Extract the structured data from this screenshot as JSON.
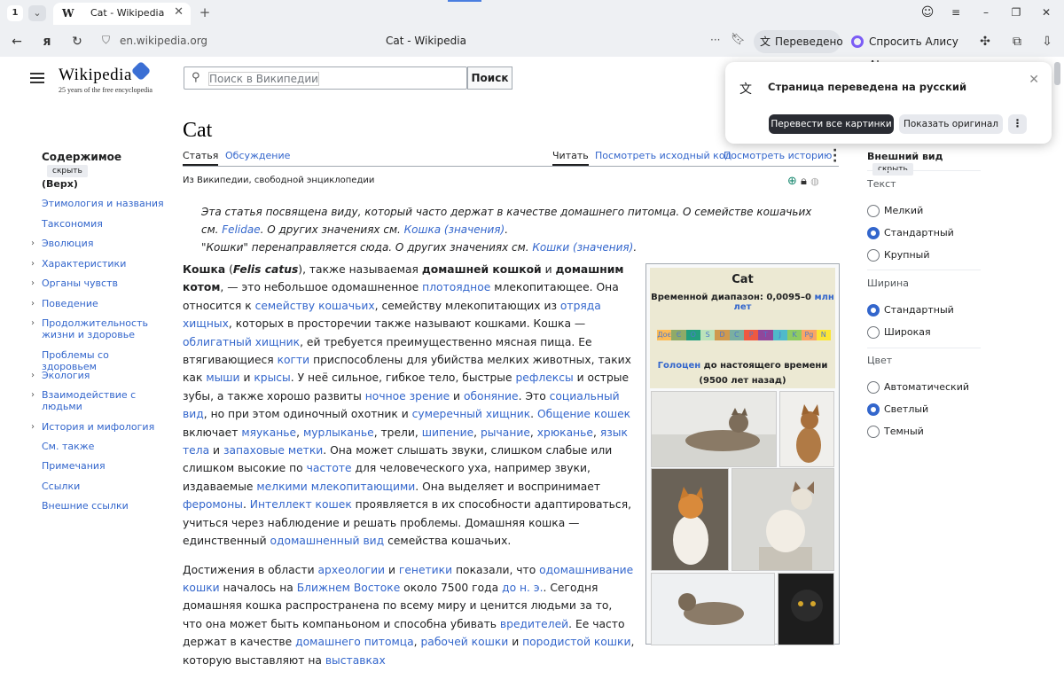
{
  "browser": {
    "tab_count": "1",
    "tab_title": "Cat - Wikipedia",
    "tab_favicon": "W",
    "url_host": "en.wikipedia.org",
    "page_title": "Cat - Wikipedia",
    "translated_label": "Переведено",
    "alice_label": "Спросить Алису AI"
  },
  "popup": {
    "message": "Страница переведена на русский",
    "translate_images": "Перевести все картинки",
    "show_original": "Показать оригинал"
  },
  "wiki": {
    "logo": "Wikipedia",
    "logo_sub": "25 years of the free encyclopedia",
    "search_placeholder": "Поиск в Википедии",
    "search_button": "Поиск",
    "toc_title": "Содержимое",
    "hide": "скрыть",
    "toc": [
      {
        "label": "(Верх)",
        "arrow": false
      },
      {
        "label": "Этимология и названия",
        "arrow": false
      },
      {
        "label": "Таксономия",
        "arrow": false
      },
      {
        "label": "Эволюция",
        "arrow": true
      },
      {
        "label": "Характеристики",
        "arrow": true
      },
      {
        "label": "Органы чувств",
        "arrow": true
      },
      {
        "label": "Поведение",
        "arrow": true
      },
      {
        "label": "Продолжительность жизни и здоровье",
        "arrow": true
      },
      {
        "label": "Проблемы со здоровьем",
        "arrow": false
      },
      {
        "label": "Экология",
        "arrow": true
      },
      {
        "label": "Взаимодействие с людьми",
        "arrow": true
      },
      {
        "label": "История и мифология",
        "arrow": true
      },
      {
        "label": "См. также",
        "arrow": false
      },
      {
        "label": "Примечания",
        "arrow": false
      },
      {
        "label": "Ссылки",
        "arrow": false
      },
      {
        "label": "Внешние ссылки",
        "arrow": false
      }
    ],
    "article_title": "Cat",
    "tabs": {
      "article": "Статья",
      "talk": "Обсуждение",
      "read": "Читать",
      "view_source": "Посмотреть исходный код",
      "history": "Посмотреть историю"
    },
    "from_wiki": "Из Википедии, свободной энциклопедии",
    "infobox": {
      "title": "Cat",
      "range": "Временной диапазон: 0,0095–0",
      "range_link": "млн лет",
      "holocene_link": "Голоцен",
      "holocene_rest": " до настоящего времени (9500 лет назад)",
      "periods": [
        "Доє",
        "Є",
        "О",
        "S",
        "D",
        "C",
        "P",
        "T",
        "J",
        "K",
        "Pg",
        "N"
      ]
    },
    "appearance": {
      "title": "Внешний вид",
      "hide": "скрыть",
      "text": "Текст",
      "small": "Мелкий",
      "standard": "Стандартный",
      "large": "Крупный",
      "width": "Ширина",
      "width_std": "Стандартный",
      "wide": "Широкая",
      "color": "Цвет",
      "auto": "Автоматический",
      "light": "Светлый",
      "dark": "Темный"
    }
  }
}
